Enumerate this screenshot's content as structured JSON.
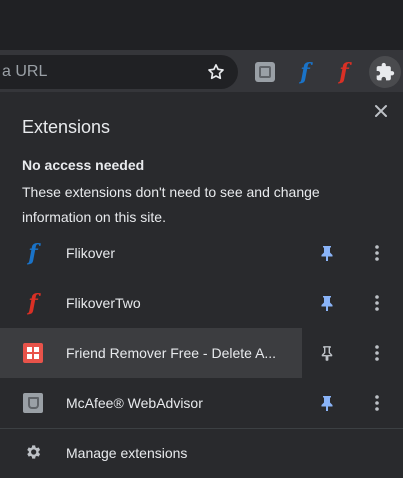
{
  "toolbar": {
    "omnibox_text": "a URL",
    "icons": [
      "bookmark-star-icon",
      "extension-tile-icon",
      "flikover-icon",
      "flikovertwo-icon",
      "extensions-puzzle-icon"
    ]
  },
  "panel": {
    "title": "Extensions",
    "section_heading": "No access needed",
    "section_desc": "These extensions don't need to see and change information on this site.",
    "extensions": [
      {
        "name": "Flikover",
        "pinned": true,
        "icon": "flikover-icon"
      },
      {
        "name": "FlikoverTwo",
        "pinned": true,
        "icon": "flikovertwo-icon"
      },
      {
        "name": "Friend Remover Free - Delete A...",
        "pinned": false,
        "icon": "friend-remover-icon"
      },
      {
        "name": "McAfee® WebAdvisor",
        "pinned": true,
        "icon": "mcafee-icon"
      }
    ],
    "manage_label": "Manage extensions"
  },
  "colors": {
    "pinned": "#8ab4f8",
    "unpinned": "#bdc1c6",
    "flikover": "#1a73c8",
    "flikovertwo": "#d93025",
    "friend_remover": "#e8534a"
  }
}
